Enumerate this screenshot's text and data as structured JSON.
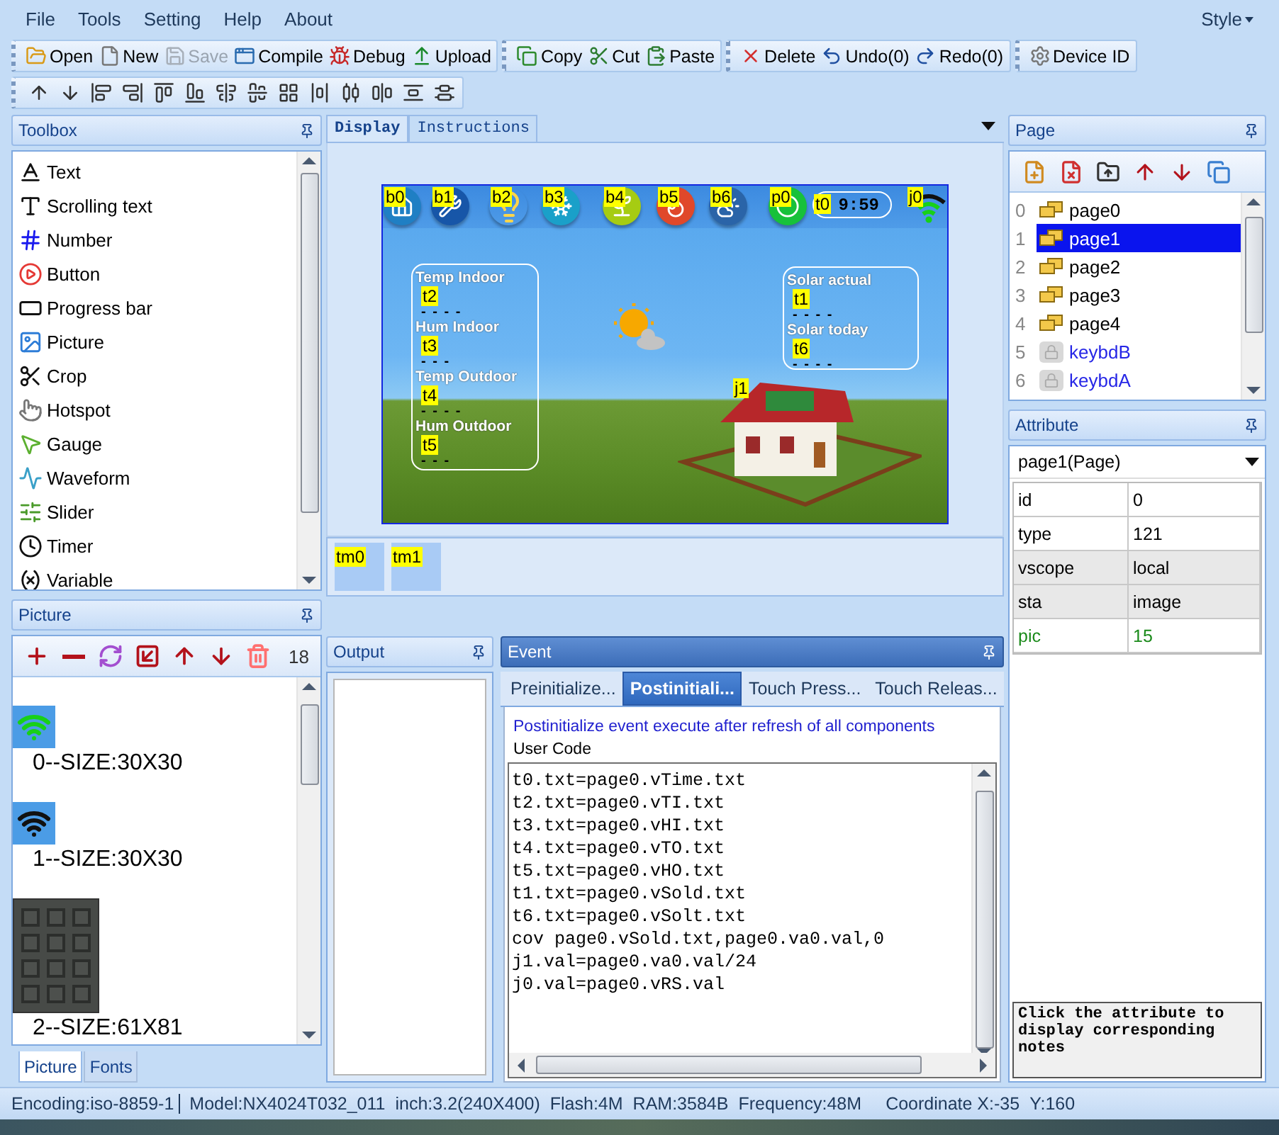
{
  "menu": [
    {
      "label": "File"
    },
    {
      "label": "Tools"
    },
    {
      "label": "Setting"
    },
    {
      "label": "Help"
    },
    {
      "label": "About"
    }
  ],
  "style_menu": "Style",
  "toolbar_groups": [
    [
      {
        "label": "Open",
        "disabled": false
      },
      {
        "label": "New",
        "disabled": false
      },
      {
        "label": "Save",
        "disabled": true
      },
      {
        "label": "Compile",
        "disabled": false
      },
      {
        "label": "Debug",
        "disabled": false
      },
      {
        "label": "Upload",
        "disabled": false
      }
    ],
    [
      {
        "label": "Copy",
        "disabled": false
      },
      {
        "label": "Cut",
        "disabled": false
      },
      {
        "label": "Paste",
        "disabled": false
      }
    ],
    [
      {
        "label": "Delete",
        "disabled": false
      },
      {
        "label": "Undo(0)",
        "disabled": false
      },
      {
        "label": "Redo(0)",
        "disabled": false
      }
    ],
    [
      {
        "label": "Device ID",
        "disabled": false
      }
    ]
  ],
  "toolbox": {
    "title": "Toolbox",
    "items": [
      {
        "label": "Text"
      },
      {
        "label": "Scrolling text"
      },
      {
        "label": "Number"
      },
      {
        "label": "Button"
      },
      {
        "label": "Progress bar"
      },
      {
        "label": "Picture"
      },
      {
        "label": "Crop"
      },
      {
        "label": "Hotspot"
      },
      {
        "label": "Gauge"
      },
      {
        "label": "Waveform"
      },
      {
        "label": "Slider"
      },
      {
        "label": "Timer"
      },
      {
        "label": "Variable"
      }
    ]
  },
  "picture_panel": {
    "title": "Picture",
    "count": "18",
    "items": [
      {
        "caption": "0--SIZE:30X30"
      },
      {
        "caption": "1--SIZE:30X30"
      },
      {
        "caption": "2--SIZE:61X81"
      }
    ],
    "tabs": [
      {
        "label": "Picture",
        "selected": true
      },
      {
        "label": "Fonts",
        "selected": false
      }
    ]
  },
  "display": {
    "tabs": [
      {
        "label": "Display",
        "selected": true
      },
      {
        "label": "Instructions",
        "selected": false
      }
    ],
    "top_components": [
      {
        "tag": "b0"
      },
      {
        "tag": "b1"
      },
      {
        "tag": "b2"
      },
      {
        "tag": "b3"
      },
      {
        "tag": "b4"
      },
      {
        "tag": "b5"
      },
      {
        "tag": "b6"
      },
      {
        "tag": "p0"
      }
    ],
    "clock": {
      "tag": "t0",
      "value": "9:59"
    },
    "gauge": {
      "tag": "j0"
    },
    "house": {
      "tag": "j1"
    },
    "left_box": [
      {
        "title": "Temp Indoor",
        "tag": "t2",
        "value": "- - - -"
      },
      {
        "title": "Hum Indoor",
        "tag": "t3",
        "value": "- - -"
      },
      {
        "title": "Temp Outdoor",
        "tag": "t4",
        "value": "- - - -"
      },
      {
        "title": "Hum Outdoor",
        "tag": "t5",
        "value": "- - -"
      }
    ],
    "right_box": [
      {
        "title": "Solar actual",
        "tag": "t1",
        "value": "- - - -"
      },
      {
        "title": "Solar today",
        "tag": "t6",
        "value": "- - - -"
      }
    ],
    "timers": [
      {
        "tag": "tm0"
      },
      {
        "tag": "tm1"
      }
    ]
  },
  "output": {
    "title": "Output"
  },
  "event": {
    "title": "Event",
    "tabs": [
      {
        "label": "Preinitialize...",
        "selected": false
      },
      {
        "label": "Postinitiali...",
        "selected": true
      },
      {
        "label": "Touch Press...",
        "selected": false
      },
      {
        "label": "Touch Releas...",
        "selected": false
      }
    ],
    "description": "Postinitialize event execute after refresh of all components",
    "code_label": "User Code",
    "code": [
      "t0.txt=page0.vTime.txt",
      "t2.txt=page0.vTI.txt",
      "t3.txt=page0.vHI.txt",
      "t4.txt=page0.vTO.txt",
      "t5.txt=page0.vHO.txt",
      "t1.txt=page0.vSold.txt",
      "t6.txt=page0.vSolt.txt",
      "cov page0.vSold.txt,page0.va0.val,0",
      "j1.val=page0.va0.val/24",
      "j0.val=page0.vRS.val"
    ]
  },
  "page_panel": {
    "title": "Page",
    "items": [
      {
        "index": "0",
        "name": "page0",
        "kind": "page",
        "selected": false
      },
      {
        "index": "1",
        "name": "page1",
        "kind": "page",
        "selected": true
      },
      {
        "index": "2",
        "name": "page2",
        "kind": "page",
        "selected": false
      },
      {
        "index": "3",
        "name": "page3",
        "kind": "page",
        "selected": false
      },
      {
        "index": "4",
        "name": "page4",
        "kind": "page",
        "selected": false
      },
      {
        "index": "5",
        "name": "keybdB",
        "kind": "locked",
        "selected": false
      },
      {
        "index": "6",
        "name": "keybdA",
        "kind": "locked",
        "selected": false
      }
    ]
  },
  "attribute_panel": {
    "title": "Attribute",
    "selector": "page1(Page)",
    "rows": [
      {
        "name": "id",
        "value": "0",
        "kind": "plain"
      },
      {
        "name": "type",
        "value": "121",
        "kind": "plain"
      },
      {
        "name": "vscope",
        "value": "local",
        "kind": "shaded"
      },
      {
        "name": "sta",
        "value": "image",
        "kind": "shaded"
      },
      {
        "name": "pic",
        "value": "15",
        "kind": "highlight"
      }
    ],
    "notes": "Click the attribute to display corresponding notes"
  },
  "status_bar": [
    "Encoding:iso-8859-1",
    "Model:NX4024T032_011",
    "inch:3.2(240X400)",
    "Flash:4M",
    "RAM:3584B",
    "Frequency:48M",
    "Coordinate X:-35",
    "Y:160"
  ]
}
